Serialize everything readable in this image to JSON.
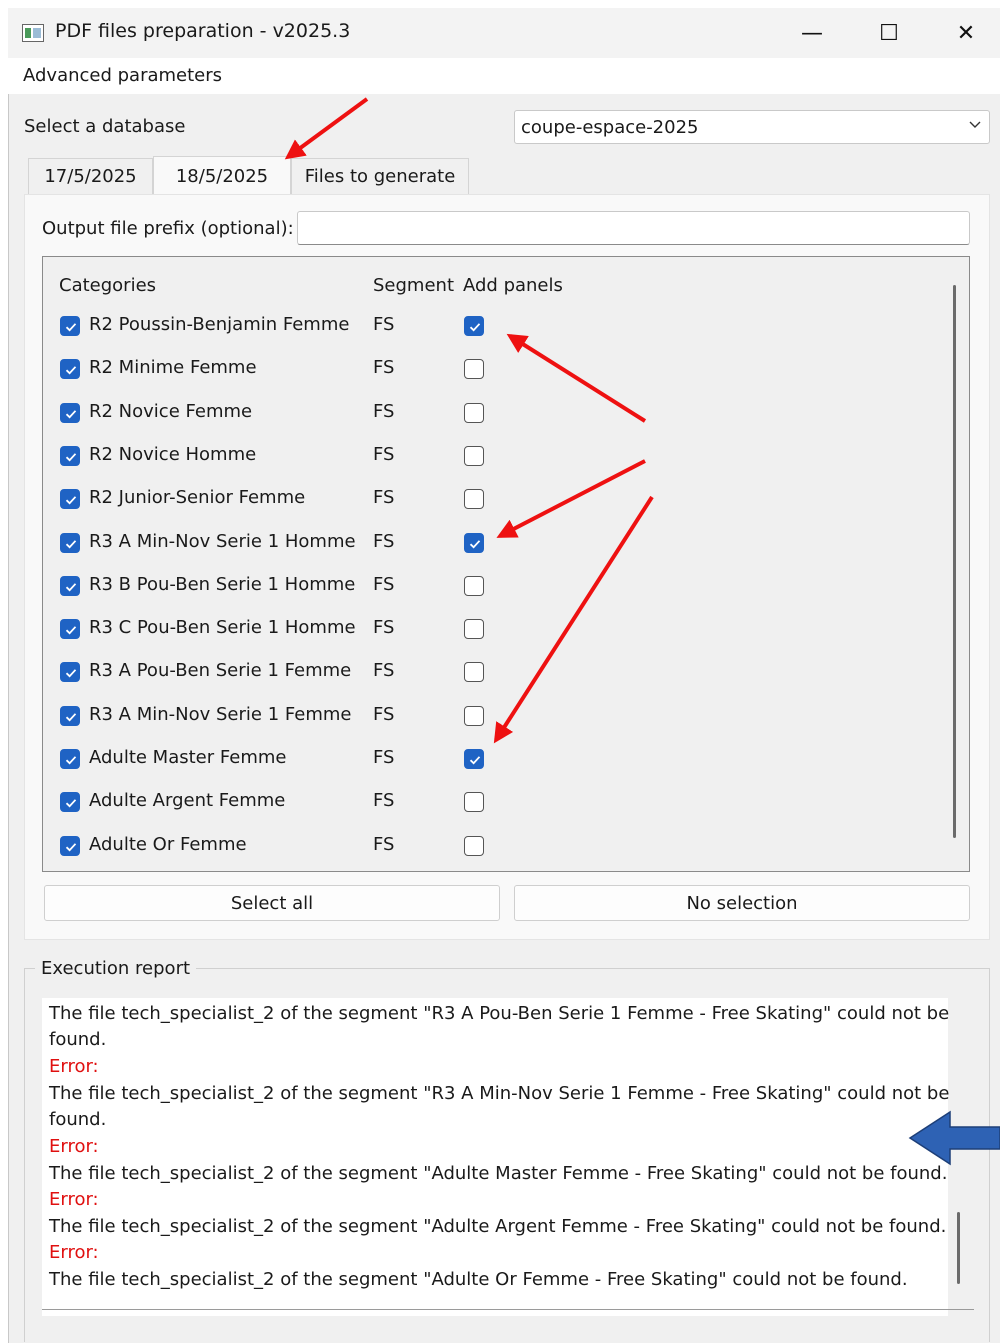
{
  "window": {
    "title": "PDF files preparation - v2025.3",
    "minimize_glyph": "—",
    "maximize_glyph": "☐",
    "close_glyph": "✕"
  },
  "menu": {
    "advanced": "Advanced parameters"
  },
  "database": {
    "label": "Select a database",
    "selected": "coupe-espace-2025"
  },
  "tabs": [
    {
      "label": "17/5/2025",
      "active": false
    },
    {
      "label": "18/5/2025",
      "active": true
    },
    {
      "label": "Files to generate",
      "active": false
    }
  ],
  "prefix": {
    "label": "Output file prefix (optional):",
    "value": ""
  },
  "table": {
    "headers": {
      "categories": "Categories",
      "segment": "Segment",
      "panels": "Add panels"
    },
    "rows": [
      {
        "category": "R2 Poussin-Benjamin Femme",
        "segment": "FS",
        "selected": true,
        "panels": true
      },
      {
        "category": "R2 Minime Femme",
        "segment": "FS",
        "selected": true,
        "panels": false
      },
      {
        "category": "R2 Novice Femme",
        "segment": "FS",
        "selected": true,
        "panels": false
      },
      {
        "category": "R2 Novice Homme",
        "segment": "FS",
        "selected": true,
        "panels": false
      },
      {
        "category": "R2 Junior-Senior Femme",
        "segment": "FS",
        "selected": true,
        "panels": false
      },
      {
        "category": "R3 A Min-Nov Serie 1 Homme",
        "segment": "FS",
        "selected": true,
        "panels": true
      },
      {
        "category": "R3 B Pou-Ben Serie 1 Homme",
        "segment": "FS",
        "selected": true,
        "panels": false
      },
      {
        "category": "R3 C Pou-Ben Serie 1 Homme",
        "segment": "FS",
        "selected": true,
        "panels": false
      },
      {
        "category": "R3 A Pou-Ben Serie 1 Femme",
        "segment": "FS",
        "selected": true,
        "panels": false
      },
      {
        "category": "R3 A Min-Nov Serie 1 Femme",
        "segment": "FS",
        "selected": true,
        "panels": false
      },
      {
        "category": "Adulte Master Femme",
        "segment": "FS",
        "selected": true,
        "panels": true
      },
      {
        "category": "Adulte Argent Femme",
        "segment": "FS",
        "selected": true,
        "panels": false
      },
      {
        "category": "Adulte Or Femme",
        "segment": "FS",
        "selected": true,
        "panels": false
      }
    ]
  },
  "buttons": {
    "select_all": "Select all",
    "no_selection": "No selection"
  },
  "report": {
    "title": "Execution report",
    "lines": [
      {
        "text": "The file tech_specialist_2 of the segment \"R3 A Pou-Ben Serie 1 Femme - Free Skating\" could not be",
        "kind": "info"
      },
      {
        "text": "found.",
        "kind": "info"
      },
      {
        "text": "Error:",
        "kind": "error"
      },
      {
        "text": "The file tech_specialist_2 of the segment \"R3 A Min-Nov Serie 1 Femme - Free Skating\" could not be",
        "kind": "info"
      },
      {
        "text": "found.",
        "kind": "info"
      },
      {
        "text": "Error:",
        "kind": "error"
      },
      {
        "text": "The file tech_specialist_2 of the segment \"Adulte Master Femme - Free Skating\" could not be found.",
        "kind": "info"
      },
      {
        "text": "Error:",
        "kind": "error"
      },
      {
        "text": "The file tech_specialist_2 of the segment \"Adulte Argent Femme - Free Skating\" could not be found.",
        "kind": "info"
      },
      {
        "text": "Error:",
        "kind": "error"
      },
      {
        "text": "The file tech_specialist_2 of the segment \"Adulte Or Femme - Free Skating\" could not be found.",
        "kind": "info"
      }
    ]
  },
  "colors": {
    "checkbox_on": "#1f63c4",
    "error_text": "#e01010",
    "annotation_arrow": "#ee1111",
    "pointer_arrow": "#2e62b4"
  }
}
